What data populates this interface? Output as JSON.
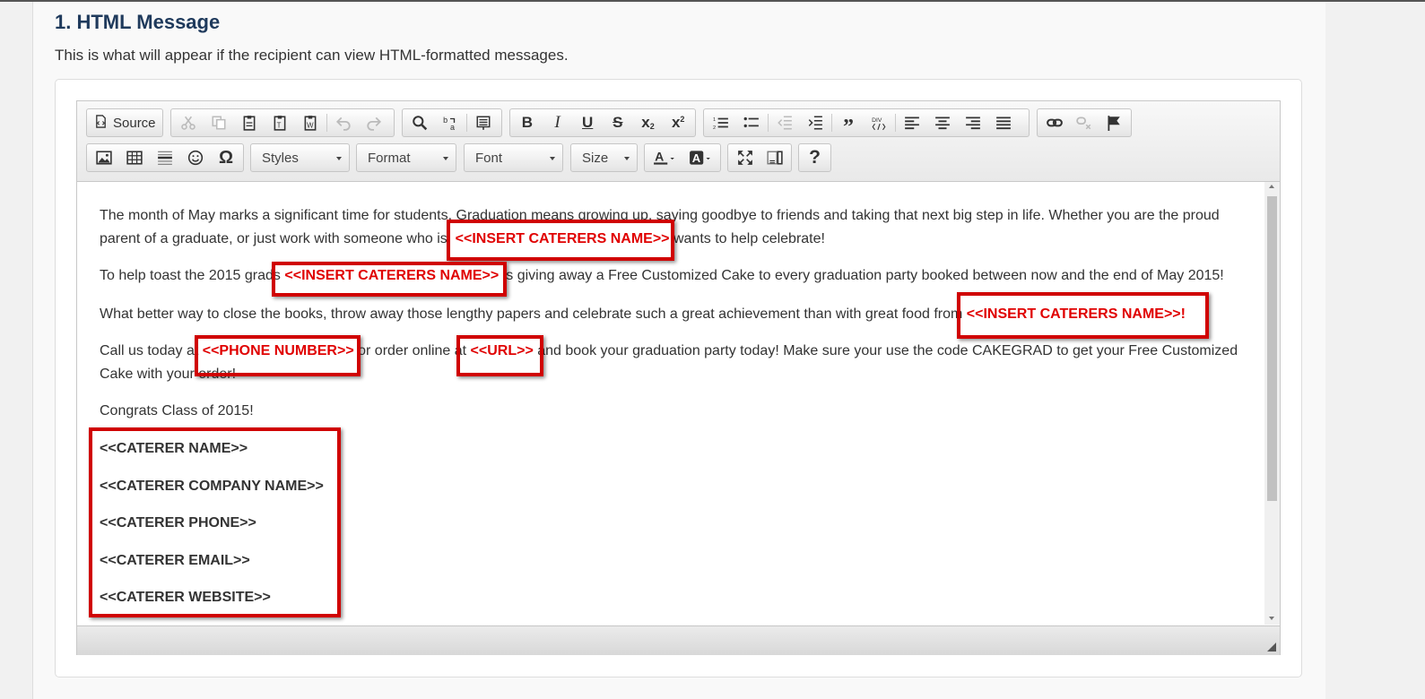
{
  "section": {
    "title": "1. HTML Message",
    "description": "This is what will appear if the recipient can view HTML-formatted messages."
  },
  "toolbar": {
    "source_label": "Source",
    "combos": {
      "styles": "Styles",
      "format": "Format",
      "font": "Font",
      "size": "Size"
    },
    "icons": [
      "cut-icon",
      "copy-icon",
      "paste-icon",
      "paste-text-icon",
      "paste-word-icon",
      "undo-icon",
      "redo-icon",
      "find-icon",
      "replace-icon",
      "select-all-icon",
      "bold-icon",
      "italic-icon",
      "underline-icon",
      "strikethrough-icon",
      "subscript-icon",
      "superscript-icon",
      "numbered-list-icon",
      "bulleted-list-icon",
      "decrease-indent-icon",
      "increase-indent-icon",
      "blockquote-icon",
      "div-icon",
      "align-left-icon",
      "align-center-icon",
      "align-right-icon",
      "justify-icon",
      "link-icon",
      "unlink-icon",
      "anchor-icon",
      "image-icon",
      "table-icon",
      "horizontal-rule-icon",
      "smiley-icon",
      "special-char-icon",
      "text-color-icon",
      "background-color-icon",
      "maximize-icon",
      "show-blocks-icon",
      "help-icon"
    ]
  },
  "content": {
    "p1": {
      "before": "The month of May marks a significant time for students. Graduation means growing up, saying goodbye to friends and taking that next big step in life. Whether you are the proud parent of a graduate, or just work with someone who is, ",
      "token": "<<INSERT CATERERS NAME>>",
      "after": " wants to help celebrate!"
    },
    "p2": {
      "before": "To help toast the 2015 grads ",
      "token": "<<INSERT CATERERS NAME>>",
      "after": " is giving away a Free Customized Cake to every graduation party booked between now and the end of May 2015!"
    },
    "p3": {
      "before": "What better way to close the books, throw away those lengthy papers and celebrate such a great achievement than with great food from ",
      "token": "<<INSERT CATERERS NAME>>!"
    },
    "p4": {
      "before": "Call us today at ",
      "token1": "<<PHONE NUMBER>>",
      "middle": " or order online at ",
      "token2": "<<URL>>",
      "after": " and book your graduation party today! Make sure your use the code CAKEGRAD to get your Free Customized Cake with your order!"
    },
    "p5": "Congrats Class of 2015!",
    "signature": [
      "<<CATERER NAME>>",
      "<<CATERER COMPANY NAME>>",
      "<<CATERER PHONE>>",
      "<<CATERER EMAIL>>",
      "<<CATERER WEBSITE>>"
    ]
  },
  "colors": {
    "placeholder_text": "#e00000",
    "highlight_box": "#d00000",
    "title": "#1f3a5c"
  }
}
